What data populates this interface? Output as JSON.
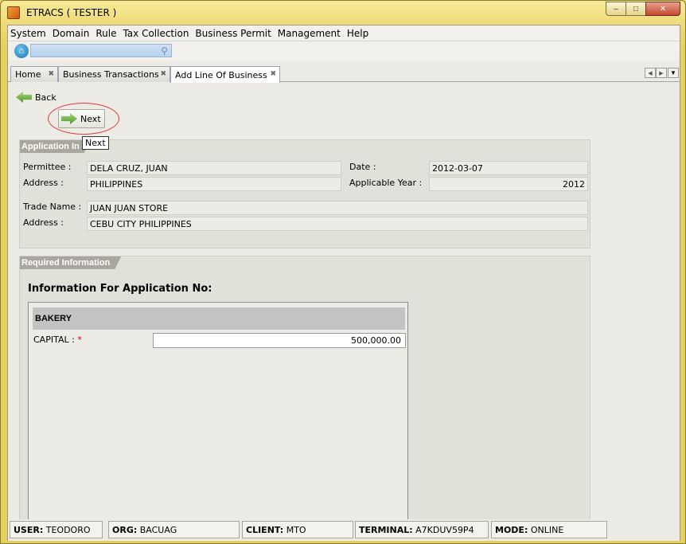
{
  "window": {
    "title": "ETRACS ( TESTER )",
    "controls": {
      "minimize": "–",
      "maximize": "□",
      "close": "✕"
    }
  },
  "menu": [
    "System",
    "Domain",
    "Rule",
    "Tax Collection",
    "Business Permit",
    "Management",
    "Help"
  ],
  "search": {
    "placeholder": "",
    "icon": "search-icon"
  },
  "tabs": [
    {
      "label": "Home",
      "active": false
    },
    {
      "label": "Business Transactions",
      "active": false
    },
    {
      "label": "Add Line Of Business",
      "active": true
    }
  ],
  "actions": {
    "back": "Back",
    "next": "Next",
    "tooltip": "Next"
  },
  "application_info": {
    "header": "Application In",
    "permittee_label": "Permittee :",
    "permittee": "DELA CRUZ, JUAN",
    "address_label": "Address :",
    "address": "PHILIPPINES",
    "date_label": "Date :",
    "date": "2012-03-07",
    "year_label": "Applicable Year :",
    "year": "2012",
    "trade_name_label": "Trade Name :",
    "trade_name": "JUAN JUAN STORE",
    "trade_address_label": "Address :",
    "trade_address": "CEBU CITY PHILIPPINES"
  },
  "required_info": {
    "header": "Required Information",
    "heading": "Information For Application No:",
    "line_of_business": "BAKERY",
    "capital_label": "CAPITAL : ",
    "required_marker": "*",
    "capital_value": "500,000.00"
  },
  "status": {
    "user_label": "USER:",
    "user": "TEODORO",
    "org_label": "ORG:",
    "org": "BACUAG",
    "client_label": "CLIENT:",
    "client": "MTO",
    "terminal_label": "TERMINAL:",
    "terminal": "A7KDUV59P4",
    "mode_label": "MODE:",
    "mode": "ONLINE"
  },
  "colors": {
    "window_frame": "#e6cf5e",
    "panel_header": "#a9a79d",
    "highlight": "#e23a3a",
    "arrow": "#4b9a2b",
    "search_field": "#c2d7ef"
  }
}
